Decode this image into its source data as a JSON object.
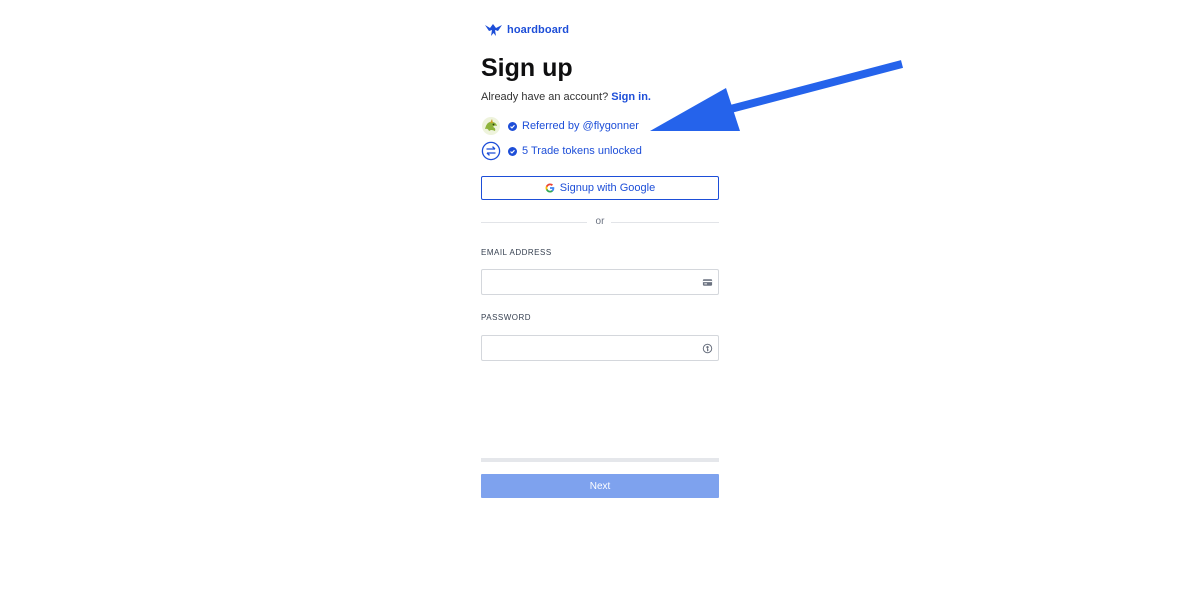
{
  "brand": {
    "name": "hoardboard",
    "color": "#1d4ed8",
    "logo_icon": "hoardboard-logo-icon"
  },
  "title": "Sign up",
  "signin_prompt": {
    "text": "Already have an account?",
    "link": "Sign in."
  },
  "perks": [
    {
      "icon": "dragon-avatar-icon",
      "text": "Referred by @flygonner"
    },
    {
      "icon": "trade-exchange-icon",
      "text": "5 Trade tokens unlocked"
    }
  ],
  "google_button": {
    "label": "Signup with Google",
    "icon": "google-icon"
  },
  "divider_text": "or",
  "email": {
    "label": "EMAIL ADDRESS",
    "value": "",
    "placeholder": "",
    "icon": "card-icon"
  },
  "password": {
    "label": "PASSWORD",
    "value": "",
    "placeholder": "",
    "icon": "key-icon"
  },
  "progress": {
    "fraction": 0
  },
  "next_button": {
    "label": "Next",
    "color": "#7ea2ee"
  },
  "annotation": {
    "type": "arrow",
    "color": "#2563eb",
    "points_to": "Referred by @flygonner"
  }
}
